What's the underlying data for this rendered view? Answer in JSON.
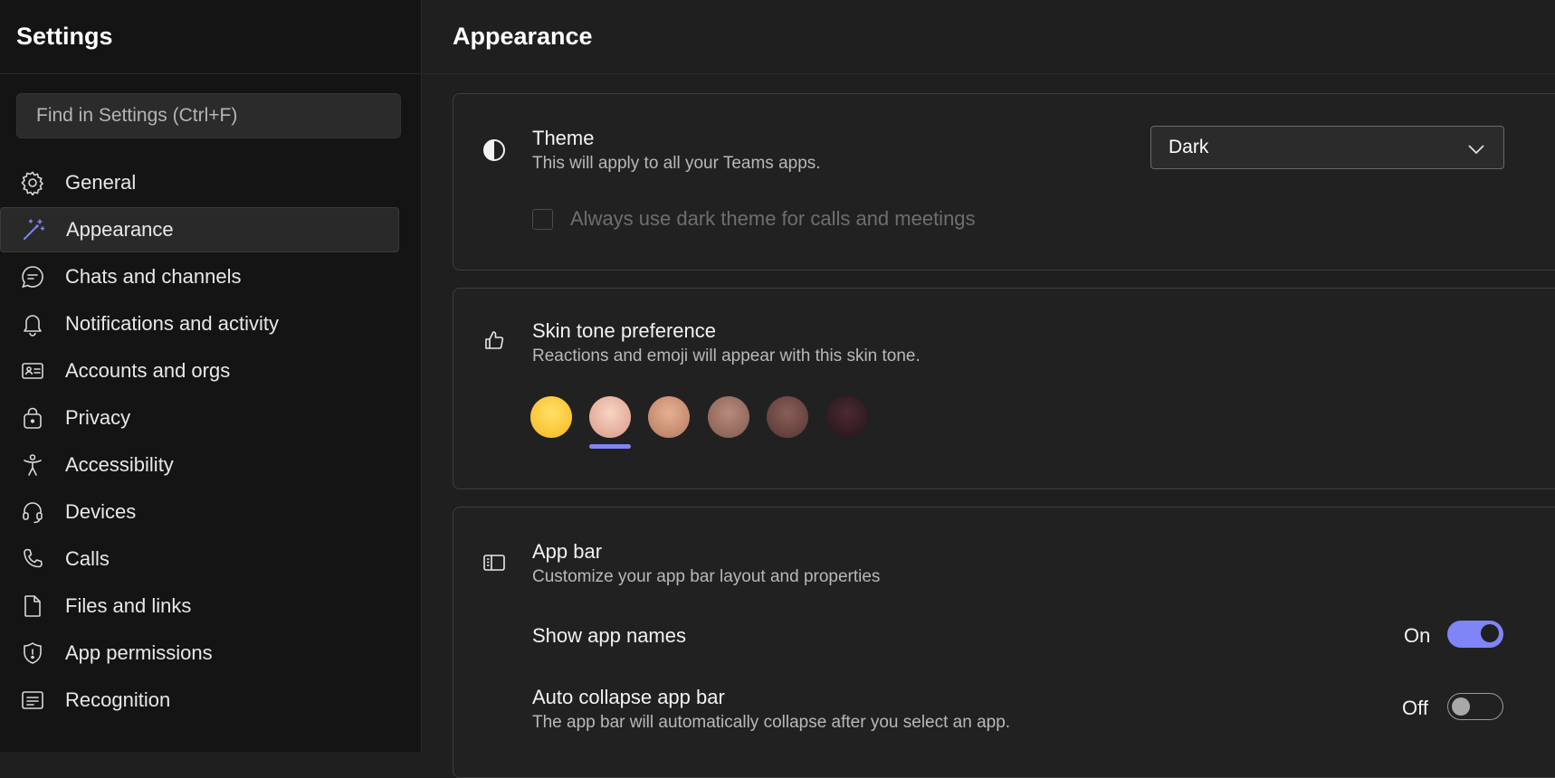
{
  "sidebar": {
    "title": "Settings",
    "search_placeholder": "Find in Settings (Ctrl+F)",
    "items": [
      {
        "label": "General",
        "icon": "gear-icon",
        "active": false
      },
      {
        "label": "Appearance",
        "icon": "magic-wand-icon",
        "active": true
      },
      {
        "label": "Chats and channels",
        "icon": "chat-bubble-icon",
        "active": false
      },
      {
        "label": "Notifications and activity",
        "icon": "bell-icon",
        "active": false
      },
      {
        "label": "Accounts and orgs",
        "icon": "id-card-icon",
        "active": false
      },
      {
        "label": "Privacy",
        "icon": "lock-icon",
        "active": false
      },
      {
        "label": "Accessibility",
        "icon": "accessibility-person-icon",
        "active": false
      },
      {
        "label": "Devices",
        "icon": "headset-icon",
        "active": false
      },
      {
        "label": "Calls",
        "icon": "phone-icon",
        "active": false
      },
      {
        "label": "Files and links",
        "icon": "document-icon",
        "active": false
      },
      {
        "label": "App permissions",
        "icon": "shield-icon",
        "active": false
      },
      {
        "label": "Recognition",
        "icon": "text-box-icon",
        "active": false
      }
    ]
  },
  "main": {
    "title": "Appearance",
    "theme": {
      "title": "Theme",
      "description": "This will apply to all your Teams apps.",
      "selected": "Dark",
      "checkbox_label": "Always use dark theme for calls and meetings",
      "checkbox_checked": false,
      "icon": "contrast-icon"
    },
    "skin_tone": {
      "title": "Skin tone preference",
      "description": "Reactions and emoji will appear with this skin tone.",
      "icon": "thumbs-up-icon",
      "selected_index": 1,
      "tones": [
        "#fdcb36",
        "#f2c2a8",
        "#d49b7c",
        "#a67a6a",
        "#7a4f4a",
        "#3a2126"
      ]
    },
    "app_bar": {
      "title": "App bar",
      "description": "Customize your app bar layout and properties",
      "icon": "app-bar-icon",
      "show_names_label": "Show app names",
      "show_names_state": "On",
      "auto_collapse_label": "Auto collapse app bar",
      "auto_collapse_desc": "The app bar will automatically collapse after you select an app.",
      "auto_collapse_state": "Off"
    }
  },
  "colors": {
    "accent": "#7f85f5",
    "sidebar_bg": "#141414",
    "main_bg": "#1f1f1f"
  }
}
